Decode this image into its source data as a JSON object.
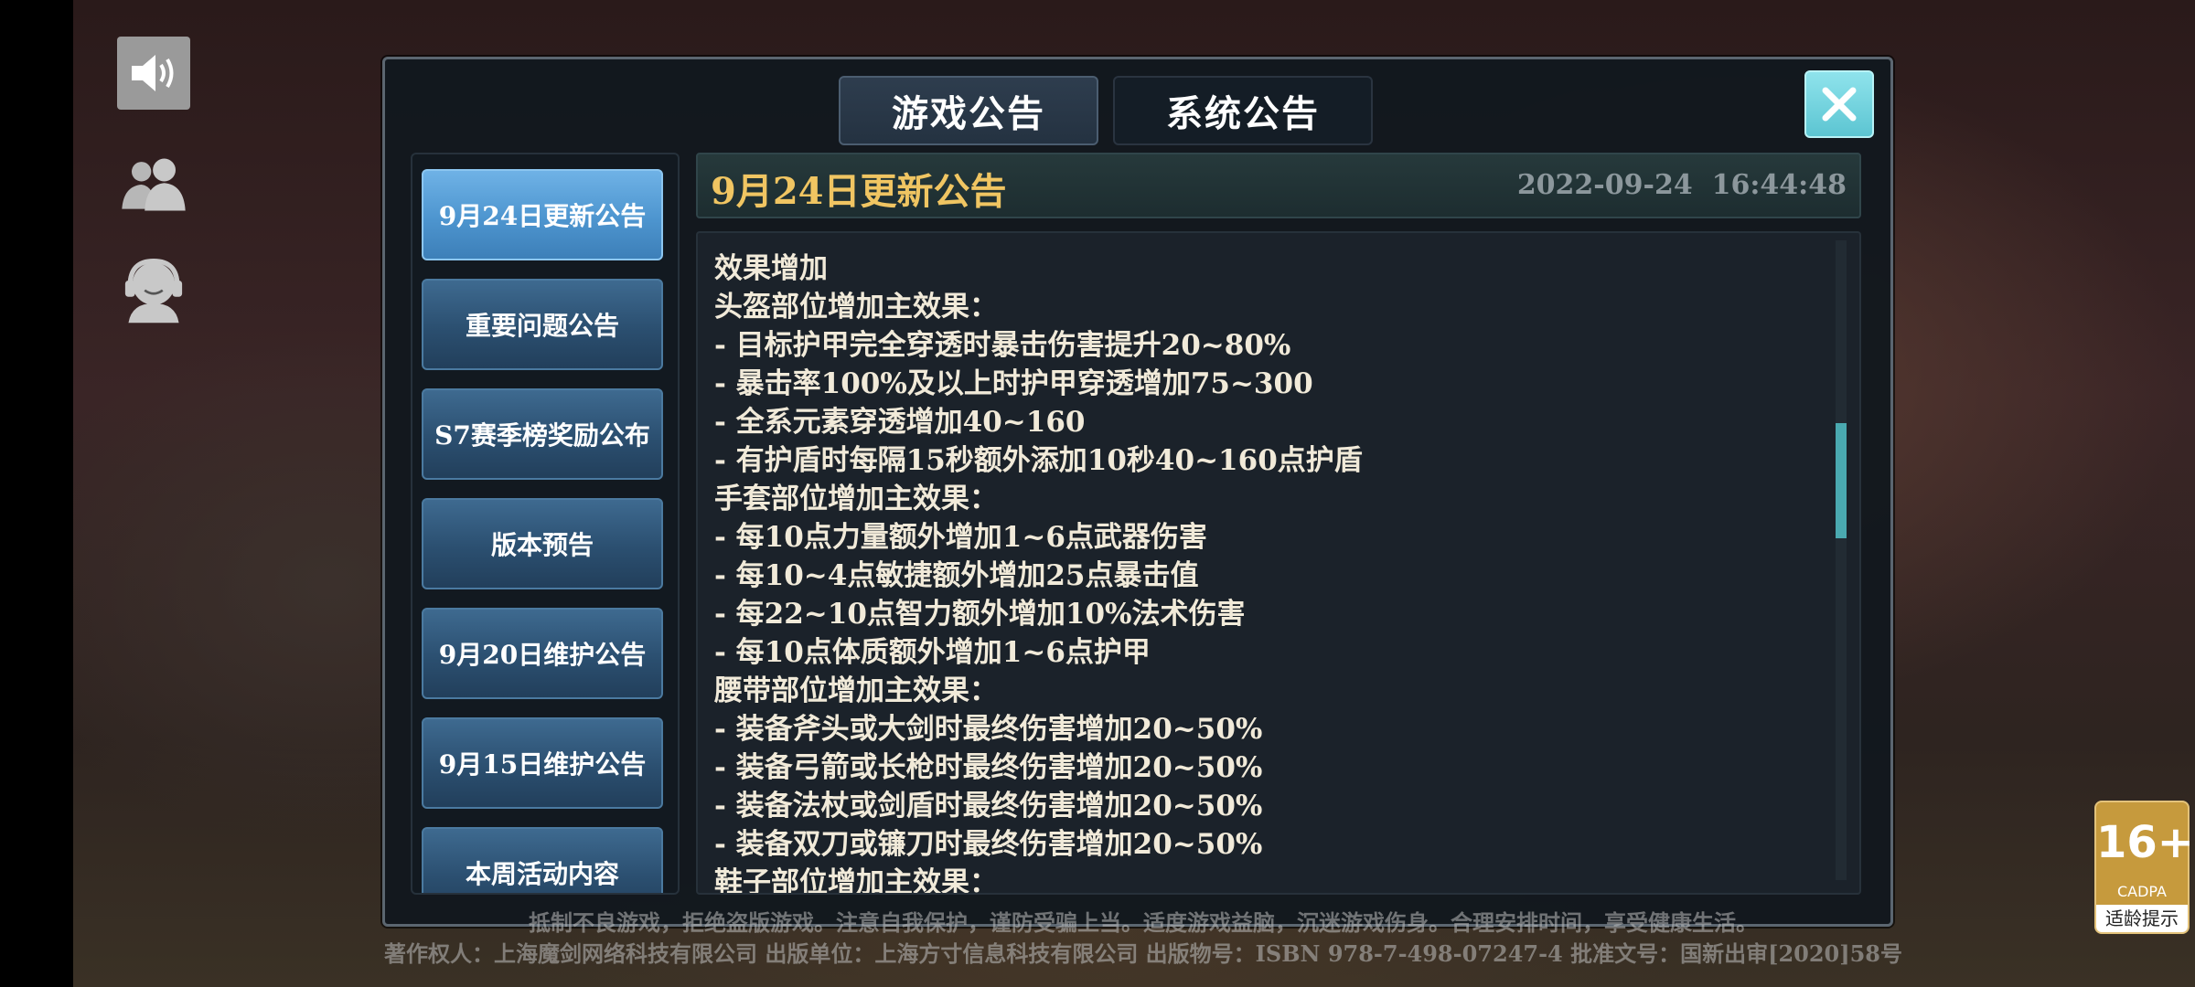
{
  "tabs": [
    {
      "label": "游戏公告",
      "active": true
    },
    {
      "label": "系统公告",
      "active": false
    }
  ],
  "sidebar_icons": [
    "speaker-icon",
    "friends-icon",
    "customer-service-icon"
  ],
  "announcement_list": [
    {
      "label": "9月24日更新公告",
      "selected": true
    },
    {
      "label": "重要问题公告",
      "selected": false
    },
    {
      "label": "S7赛季榜奖励公布",
      "selected": false
    },
    {
      "label": "版本预告",
      "selected": false
    },
    {
      "label": "9月20日维护公告",
      "selected": false
    },
    {
      "label": "9月15日维护公告",
      "selected": false
    },
    {
      "label": "本周活动内容",
      "selected": false
    }
  ],
  "article": {
    "title": "9月24日更新公告",
    "datetime": "2022-09-24  16:44:48",
    "lines": [
      "效果增加",
      "头盔部位增加主效果：",
      "- 目标护甲完全穿透时暴击伤害提升20~80%",
      "- 暴击率100%及以上时护甲穿透增加75~300",
      "- 全系元素穿透增加40~160",
      "- 有护盾时每隔15秒额外添加10秒40~160点护盾",
      "手套部位增加主效果：",
      "- 每10点力量额外增加1~6点武器伤害",
      "- 每10~4点敏捷额外增加25点暴击值",
      "- 每22~10点智力额外增加10%法术伤害",
      "- 每10点体质额外增加1~6点护甲",
      "腰带部位增加主效果：",
      "- 装备斧头或大剑时最终伤害增加20~50%",
      "- 装备弓箭或长枪时最终伤害增加20~50%",
      "- 装备法杖或剑盾时最终伤害增加20~50%",
      "- 装备双刀或镰刀时最终伤害增加20~50%",
      "鞋子部位增加主效果："
    ]
  },
  "footer": {
    "line1": "抵制不良游戏，拒绝盗版游戏。注意自我保护，谨防受骗上当。适度游戏益脑，沉迷游戏伤身。合理安排时间，享受健康生活。",
    "line2": "著作权人：上海魔剑网络科技有限公司 出版单位：上海方寸信息科技有限公司 出版物号：ISBN 978-7-498-07247-4 批准文号：国新出审[2020]58号"
  },
  "age_rating": {
    "value": "16+",
    "org": "CADPA",
    "tip": "适龄提示"
  },
  "colors": {
    "title_gold": "#f0c562",
    "selected_item": "#4d95cf",
    "close_button": "#6fd0db",
    "scroll_thumb": "#4aa9b0"
  }
}
